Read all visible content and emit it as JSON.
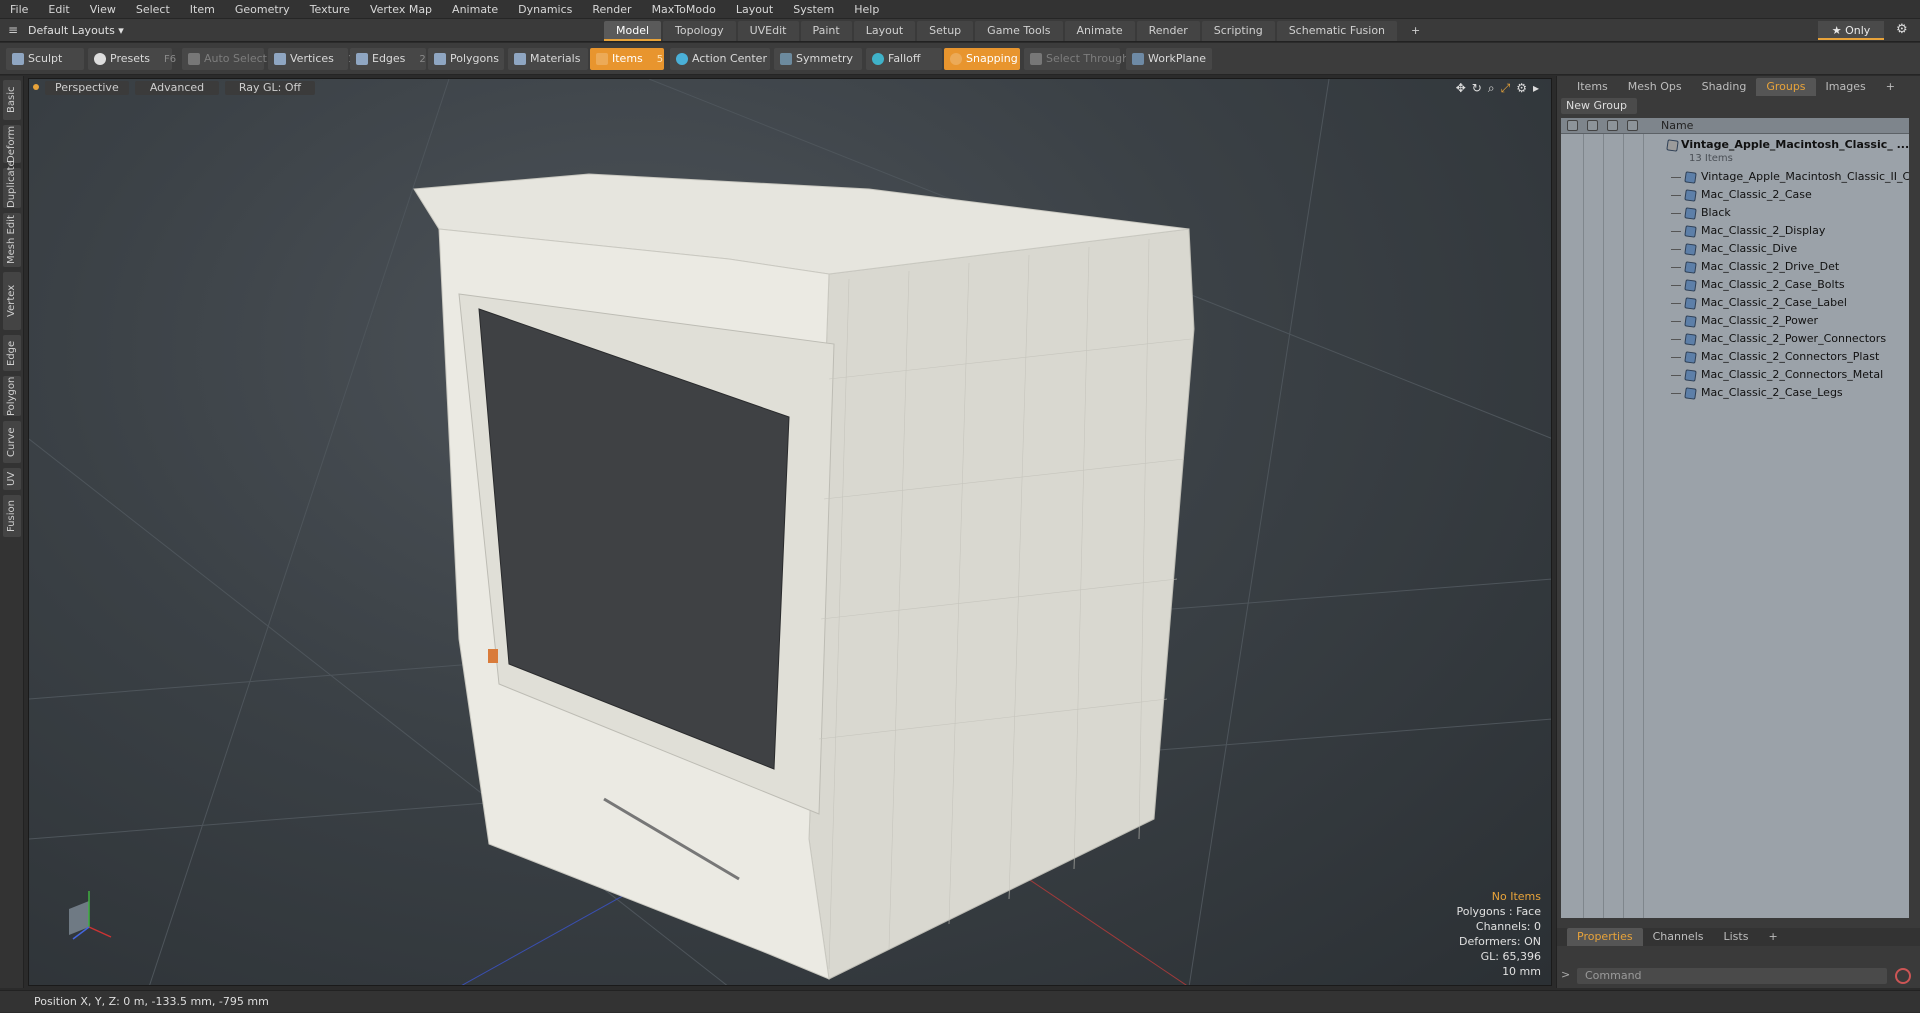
{
  "menu": [
    "File",
    "Edit",
    "View",
    "Select",
    "Item",
    "Geometry",
    "Texture",
    "Vertex Map",
    "Animate",
    "Dynamics",
    "Render",
    "MaxToModo",
    "Layout",
    "System",
    "Help"
  ],
  "layout_select": "Default Layouts ▾",
  "tabs": [
    {
      "label": "Model",
      "active": true
    },
    {
      "label": "Topology"
    },
    {
      "label": "UVEdit"
    },
    {
      "label": "Paint"
    },
    {
      "label": "Layout"
    },
    {
      "label": "Setup"
    },
    {
      "label": "Game Tools"
    },
    {
      "label": "Animate"
    },
    {
      "label": "Render"
    },
    {
      "label": "Scripting"
    },
    {
      "label": "Schematic Fusion"
    }
  ],
  "tab_add": "+",
  "only_btn": "★ Only",
  "toolbar": {
    "sculpt": "Sculpt",
    "presets": "Presets",
    "presets_key": "F6",
    "auto_select": "Auto Select",
    "vertices": "Vertices",
    "vertices_key": "1",
    "edges": "Edges",
    "edges_key": "2",
    "polygons": "Polygons",
    "materials": "Materials",
    "items": "Items",
    "items_key": "5",
    "action_center": "Action Center",
    "symmetry": "Symmetry",
    "falloff": "Falloff",
    "snapping": "Snapping",
    "select_through": "Select Through",
    "workplane": "WorkPlane"
  },
  "vtabs": [
    "Basic",
    "Deform",
    "Duplicate",
    "Mesh Edit",
    "Vertex",
    "Edge",
    "Polygon",
    "Curve",
    "UV",
    "Fusion"
  ],
  "viewport": {
    "view": "Perspective",
    "shading": "Advanced",
    "raygl": "Ray GL: Off",
    "info": {
      "no_items": "No Items",
      "polygons": "Polygons : Face",
      "channels": "Channels: 0",
      "deformers": "Deformers: ON",
      "gl": "GL: 65,396",
      "unit": "10 mm"
    }
  },
  "right_panel": {
    "tabs": [
      {
        "label": "Items"
      },
      {
        "label": "Mesh Ops"
      },
      {
        "label": "Shading"
      },
      {
        "label": "Groups",
        "active": true
      },
      {
        "label": "Images"
      }
    ],
    "tabs_add": "+",
    "new_group": "New Group",
    "col_name": "Name",
    "group_name": "Vintage_Apple_Macintosh_Classic_ ...",
    "group_count": "13 Items",
    "items": [
      "Vintage_Apple_Macintosh_Classic_II_C ...",
      "Mac_Classic_2_Case",
      "Black",
      "Mac_Classic_2_Display",
      "Mac_Classic_Dive",
      "Mac_Classic_2_Drive_Det",
      "Mac_Classic_2_Case_Bolts",
      "Mac_Classic_2_Case_Label",
      "Mac_Classic_2_Power",
      "Mac_Classic_2_Power_Connectors",
      "Mac_Classic_2_Connectors_Plast",
      "Mac_Classic_2_Connectors_Metal",
      "Mac_Classic_2_Case_Legs"
    ],
    "bottom_tabs": [
      {
        "label": "Properties",
        "active": true
      },
      {
        "label": "Channels"
      },
      {
        "label": "Lists"
      }
    ],
    "bottom_add": "+",
    "command_placeholder": "Command"
  },
  "status": "Position X, Y, Z:  0 m, -133.5 mm, -795 mm",
  "colors": {
    "accent": "#e8a33a",
    "viewport_bg": "#3b4146",
    "tree_bg": "#9ba2a9"
  }
}
